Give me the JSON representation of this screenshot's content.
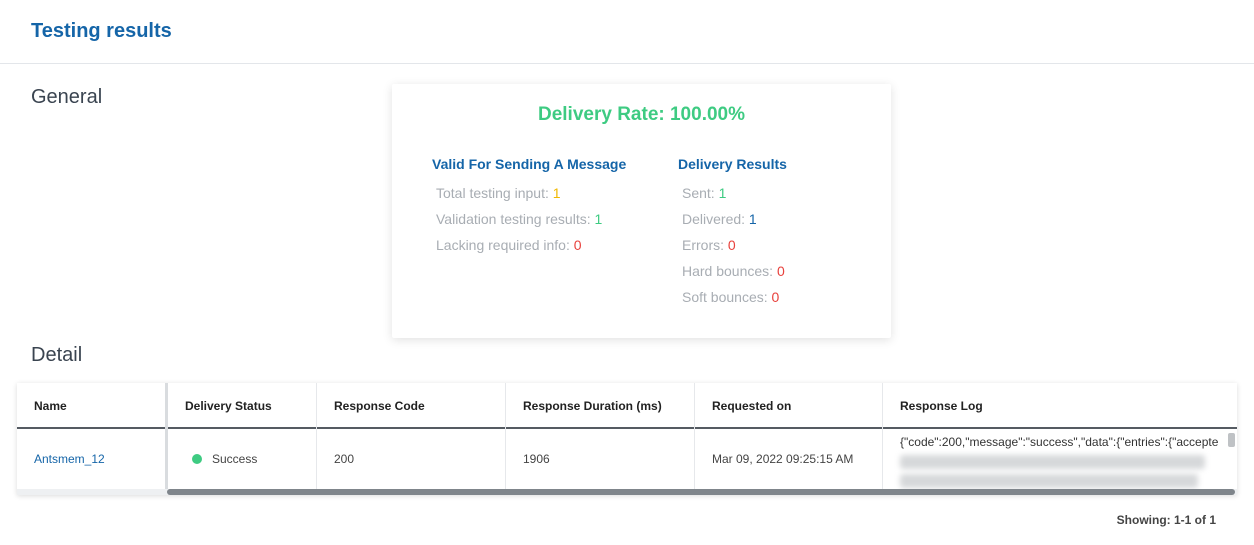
{
  "header": {
    "title": "Testing results"
  },
  "general": {
    "title": "General",
    "delivery_rate": "Delivery Rate: 100.00%",
    "valid": {
      "heading": "Valid For Sending A Message",
      "items": [
        {
          "label": "Total testing input: ",
          "value": "1"
        },
        {
          "label": "Validation testing results: ",
          "value": "1"
        },
        {
          "label": "Lacking required info: ",
          "value": "0"
        }
      ]
    },
    "delivery": {
      "heading": "Delivery Results",
      "items": [
        {
          "label": "Sent: ",
          "value": "1"
        },
        {
          "label": "Delivered: ",
          "value": "1"
        },
        {
          "label": "Errors: ",
          "value": "0"
        },
        {
          "label": "Hard bounces: ",
          "value": "0"
        },
        {
          "label": "Soft bounces: ",
          "value": "0"
        }
      ]
    }
  },
  "detail": {
    "title": "Detail",
    "columns": [
      "Name",
      "Delivery Status",
      "Response Code",
      "Response Duration (ms)",
      "Requested on",
      "Response Log"
    ],
    "rows": [
      {
        "name": "Antsmem_12",
        "status": "Success",
        "code": "200",
        "duration": "1906",
        "requested_on": "Mar 09, 2022 09:25:15 AM",
        "log": "{\"code\":200,\"message\":\"success\",\"data\":{\"entries\":{\"accepte"
      }
    ]
  },
  "footer": {
    "showing": "Showing: 1-1 of 1"
  }
}
